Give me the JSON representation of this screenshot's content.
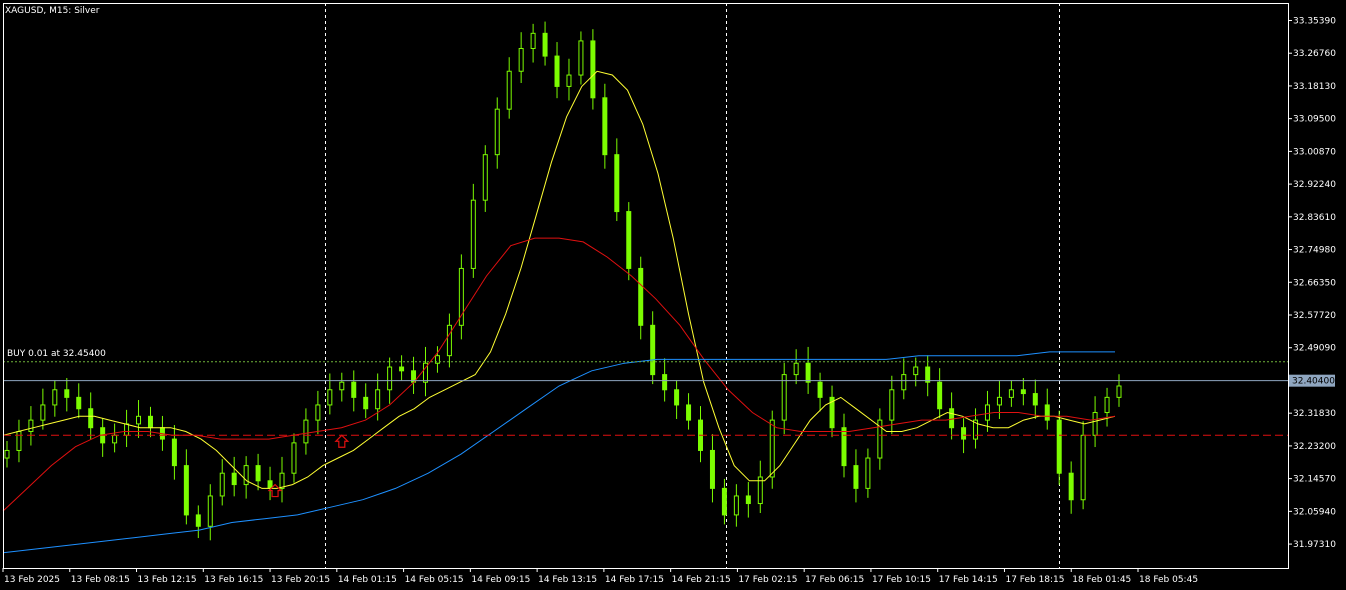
{
  "header": {
    "symbol_label": "XAGUSD, M15:  Silver"
  },
  "trade": {
    "label": "BUY 0.01 at 32.45400",
    "price": 32.454
  },
  "current_price": {
    "value": 32.404,
    "label": "32.40400"
  },
  "colors": {
    "background": "#000000",
    "candle": "#7CFC00",
    "ma_fast": "#FFFF33",
    "ma_mid": "#E01010",
    "ma_slow": "#1E90FF",
    "trade_line": "#6FB33A",
    "stop_line": "#E01010",
    "separator": "#FFFFFF",
    "axis_text": "#FFFFFF",
    "arrow": "#E01010"
  },
  "chart_data": {
    "type": "candlestick",
    "title": "XAGUSD, M15:  Silver",
    "ylim": [
      31.91,
      33.4
    ],
    "y_ticks": [
      {
        "value": 33.3539,
        "label": "33.35390"
      },
      {
        "value": 33.2676,
        "label": "33.26760"
      },
      {
        "value": 33.1813,
        "label": "33.18130"
      },
      {
        "value": 33.095,
        "label": "33.09500"
      },
      {
        "value": 33.0087,
        "label": "33.00870"
      },
      {
        "value": 32.9224,
        "label": "32.92240"
      },
      {
        "value": 32.8361,
        "label": "32.83610"
      },
      {
        "value": 32.7498,
        "label": "32.74980"
      },
      {
        "value": 32.6635,
        "label": "32.66350"
      },
      {
        "value": 32.5772,
        "label": "32.57720"
      },
      {
        "value": 32.4909,
        "label": "32.49090"
      },
      {
        "value": 32.3183,
        "label": "32.31830"
      },
      {
        "value": 32.232,
        "label": "32.23200"
      },
      {
        "value": 32.1457,
        "label": "32.14570"
      },
      {
        "value": 32.0594,
        "label": "32.05940"
      },
      {
        "value": 31.9731,
        "label": "31.97310"
      }
    ],
    "x_ticks": [
      "13 Feb 2025",
      "13 Feb 08:15",
      "13 Feb 12:15",
      "13 Feb 16:15",
      "13 Feb 20:15",
      "14 Feb 01:15",
      "14 Feb 05:15",
      "14 Feb 09:15",
      "14 Feb 13:15",
      "14 Feb 17:15",
      "14 Feb 21:15",
      "17 Feb 02:15",
      "17 Feb 06:15",
      "17 Feb 10:15",
      "17 Feb 14:15",
      "17 Feb 18:15",
      "18 Feb 01:45",
      "18 Feb 05:45"
    ],
    "separators": [
      "13 Feb 20:15",
      "14 Feb 21:15",
      "17 Feb 18:15"
    ],
    "stop_level": 32.26,
    "buy_arrows": [
      {
        "at": "13 Feb 20:15",
        "price": 32.13
      },
      {
        "at": "14 Feb 01:15",
        "price": 32.26
      }
    ],
    "closes": [
      32.22,
      32.27,
      32.3,
      32.34,
      32.38,
      32.36,
      32.33,
      32.28,
      32.24,
      32.26,
      32.29,
      32.31,
      32.28,
      32.25,
      32.18,
      32.05,
      32.02,
      32.1,
      32.16,
      32.13,
      32.18,
      32.14,
      32.12,
      32.16,
      32.24,
      32.3,
      32.34,
      32.38,
      32.4,
      32.36,
      32.33,
      32.38,
      32.44,
      32.43,
      32.4,
      32.45,
      32.47,
      32.55,
      32.7,
      32.88,
      33.0,
      33.12,
      33.22,
      33.28,
      33.32,
      33.26,
      33.18,
      33.21,
      33.3,
      33.15,
      33.0,
      32.85,
      32.7,
      32.55,
      32.42,
      32.38,
      32.34,
      32.3,
      32.22,
      32.12,
      32.05,
      32.1,
      32.08,
      32.15,
      32.3,
      32.42,
      32.45,
      32.4,
      32.36,
      32.28,
      32.18,
      32.12,
      32.2,
      32.3,
      32.38,
      32.42,
      32.44,
      32.4,
      32.33,
      32.28,
      32.25,
      32.3,
      32.34,
      32.36,
      32.38,
      32.37,
      32.34,
      32.3,
      32.16,
      32.09,
      32.26,
      32.32,
      32.36,
      32.39
    ],
    "series": [
      {
        "name": "ma_fast",
        "type": "line",
        "values": [
          32.26,
          32.27,
          32.28,
          32.29,
          32.3,
          32.31,
          32.31,
          32.3,
          32.29,
          32.28,
          32.28,
          32.28,
          32.27,
          32.25,
          32.22,
          32.18,
          32.14,
          32.12,
          32.12,
          32.13,
          32.15,
          32.18,
          32.2,
          32.22,
          32.25,
          32.28,
          32.31,
          32.33,
          32.36,
          32.38,
          32.4,
          32.42,
          32.48,
          32.58,
          32.7,
          32.84,
          32.98,
          33.1,
          33.18,
          33.22,
          33.21,
          33.17,
          33.08,
          32.95,
          32.78,
          32.58,
          32.4,
          32.28,
          32.18,
          32.14,
          32.14,
          32.18,
          32.24,
          32.3,
          32.34,
          32.36,
          32.33,
          32.3,
          32.27,
          32.27,
          32.28,
          32.3,
          32.32,
          32.31,
          32.29,
          32.28,
          32.28,
          32.3,
          32.31,
          32.31,
          32.3,
          32.29,
          32.3,
          32.31
        ]
      },
      {
        "name": "ma_mid",
        "type": "line",
        "values": [
          32.06,
          32.12,
          32.18,
          32.23,
          32.26,
          32.27,
          32.27,
          32.26,
          32.26,
          32.25,
          32.25,
          32.25,
          32.26,
          32.27,
          32.28,
          32.3,
          32.34,
          32.4,
          32.48,
          32.58,
          32.68,
          32.76,
          32.78,
          32.78,
          32.77,
          32.73,
          32.68,
          32.62,
          32.55,
          32.46,
          32.38,
          32.32,
          32.28,
          32.27,
          32.27,
          32.27,
          32.28,
          32.29,
          32.3,
          32.3,
          32.31,
          32.32,
          32.32,
          32.31,
          32.31,
          32.3,
          32.31
        ]
      },
      {
        "name": "ma_slow",
        "type": "line",
        "values": [
          31.95,
          31.96,
          31.97,
          31.98,
          31.99,
          32.0,
          32.01,
          32.03,
          32.04,
          32.05,
          32.07,
          32.09,
          32.12,
          32.16,
          32.21,
          32.27,
          32.33,
          32.39,
          32.43,
          32.45,
          32.46,
          32.46,
          32.46,
          32.46,
          32.46,
          32.46,
          32.46,
          32.46,
          32.47,
          32.47,
          32.47,
          32.47,
          32.48,
          32.48,
          32.48
        ]
      }
    ]
  }
}
